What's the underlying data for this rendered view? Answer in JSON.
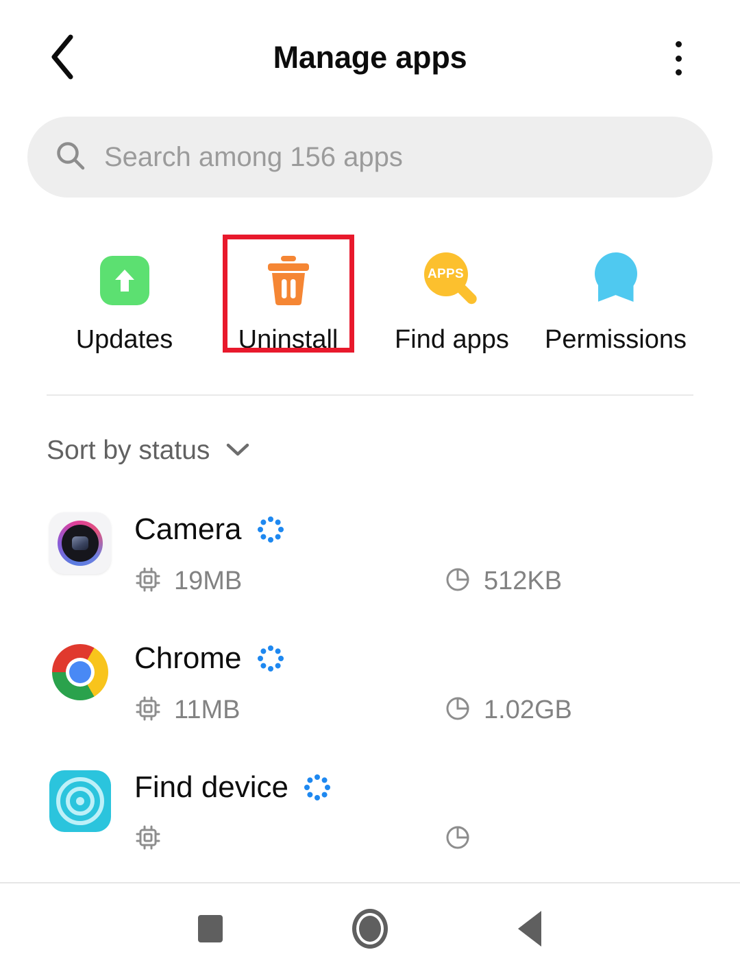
{
  "header": {
    "title": "Manage apps",
    "back_icon": "chevron-left-icon",
    "overflow_icon": "more-vertical-icon"
  },
  "search": {
    "icon": "search-icon",
    "placeholder": "Search among 156 apps",
    "value": "",
    "app_count": 156
  },
  "quick_actions": [
    {
      "id": "updates",
      "label": "Updates",
      "icon": "arrow-up-box-icon",
      "color": "#5ce071",
      "highlighted": false
    },
    {
      "id": "uninstall",
      "label": "Uninstall",
      "icon": "trash-icon",
      "color": "#f58634",
      "highlighted": true
    },
    {
      "id": "find-apps",
      "label": "Find apps",
      "icon": "apps-magnifier-icon",
      "color": "#fcc02e",
      "highlighted": false,
      "badge_text": "APPS"
    },
    {
      "id": "permissions",
      "label": "Permissions",
      "icon": "person-badge-icon",
      "color": "#4fc9f0",
      "highlighted": false
    }
  ],
  "highlight": {
    "color": "#e8192c",
    "target": "uninstall"
  },
  "sort": {
    "label": "Sort by status",
    "chevron_icon": "chevron-down-icon"
  },
  "app_list": [
    {
      "name": "Camera",
      "status_icon": "loading-spinner-icon",
      "memory_icon": "cpu-chip-icon",
      "memory": "19MB",
      "storage_icon": "pie-chart-icon",
      "storage": "512KB",
      "app_icon": "camera-app-icon"
    },
    {
      "name": "Chrome",
      "status_icon": "loading-spinner-icon",
      "memory_icon": "cpu-chip-icon",
      "memory": "11MB",
      "storage_icon": "pie-chart-icon",
      "storage": "1.02GB",
      "app_icon": "chrome-app-icon"
    },
    {
      "name": "Find device",
      "status_icon": "loading-spinner-icon",
      "memory_icon": "cpu-chip-icon",
      "memory": "",
      "storage_icon": "pie-chart-icon",
      "storage": "",
      "app_icon": "find-device-app-icon"
    }
  ],
  "navbar": {
    "recents": "recents-square-icon",
    "home": "home-circle-icon",
    "back": "back-triangle-icon"
  }
}
